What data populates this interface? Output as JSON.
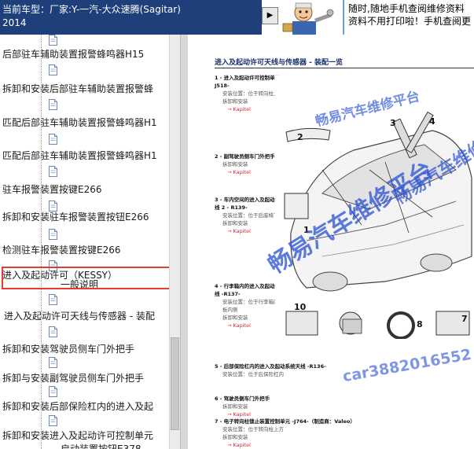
{
  "header": {
    "vehicle_label": "当前车型：厂家:Y-一汽-大众速腾(Sagitar)",
    "vehicle_year": "2014",
    "nav_button_icon": "play-forward-icon",
    "banner_line1": "随时,随地手机查阅维修资料",
    "banner_line2": "资料不用打印啦！手机查阅更"
  },
  "tree": {
    "items": [
      {
        "label": ""
      },
      {
        "label": "后部驻车辅助装置报警蜂鸣器H15"
      },
      {
        "label": ""
      },
      {
        "label": "拆卸和安装后部驻车辅助装置报警蜂"
      },
      {
        "label": ""
      },
      {
        "label": "匹配后部驻车辅助装置报警蜂鸣器H1"
      },
      {
        "label": ""
      },
      {
        "label": "匹配后部驻车辅助装置报警蜂鸣器H1"
      },
      {
        "label": ""
      },
      {
        "label": "驻车报警装置按键E266"
      },
      {
        "label": ""
      },
      {
        "label": "拆卸和安装驻车报警装置按钮E266"
      },
      {
        "label": ""
      },
      {
        "label": "检测驻车报警装置按键E266"
      },
      {
        "label": ""
      },
      {
        "label": "进入及起动许可（KESSY）"
      },
      {
        "label": "一般说明"
      },
      {
        "label": ""
      },
      {
        "label": "进入及起动许可天线与传感器 - 装配"
      },
      {
        "label": ""
      },
      {
        "label": "拆卸和安装驾驶员侧车门外把手"
      },
      {
        "label": ""
      },
      {
        "label": "拆卸与安装副驾驶员侧车门外把手"
      },
      {
        "label": ""
      },
      {
        "label": "拆卸和安装后部保险杠内的进入及起"
      },
      {
        "label": ""
      },
      {
        "label": "拆卸和安装进入及起动许可控制单元"
      },
      {
        "label": "启动装置按钮E378"
      }
    ],
    "selected_label": "进入及起动许可天线与传感器 - 装配"
  },
  "document": {
    "title": "进入及起动许可天线与传感器 - 装配一览",
    "items": [
      {
        "num": "1 -",
        "title": "进入及起动许可控制单元 -J518-",
        "sub": [
          "安装位置：位于转向柱上方",
          "拆卸和安装"
        ],
        "link": "→ Kapitel"
      },
      {
        "num": "2 -",
        "title": "副驾驶员侧车门外把手",
        "sub": [
          "拆卸和安装"
        ],
        "link": "→ Kapitel"
      },
      {
        "num": "3 -",
        "title": "车内空间的进入及起动系统天线 2 - R139-",
        "sub": [
          "安装位置：位于后座椅下方",
          "拆卸和安装"
        ],
        "link": "→ Kapitel"
      },
      {
        "num": "4 -",
        "title": "行李箱内的进入及起动系统天线 -R137-",
        "sub": [
          "安装位置：位于行李箱内装饰板内侧",
          "拆卸和安装"
        ],
        "link": "→ Kapitel"
      },
      {
        "num": "5 -",
        "title": "后部保险杠内的进入及起动系统天线 -R136-",
        "sub": [
          "安装位置：位于后保险杠内"
        ],
        "link": ""
      },
      {
        "num": "6 -",
        "title": "驾驶员侧车门外把手",
        "sub": [
          "拆卸和安装"
        ],
        "link": "→ Kapitel"
      },
      {
        "num": "7 -",
        "title": "电子转向柱锁止装置控制单元 -J764-（制造商：Valeo）",
        "sub": [
          "安装位置：位于转向柱上方",
          "拆卸和安装"
        ],
        "link": "→ Kapitel"
      }
    ],
    "callouts": [
      "1",
      "2",
      "3",
      "4",
      "7",
      "8",
      "9",
      "10"
    ]
  },
  "watermarks": {
    "platform_small": "畅易汽车维修平台",
    "platform_large": "畅易汽车维修平台",
    "platform_mid": "畅易汽车维修平台",
    "contact": "car3882016552"
  },
  "colors": {
    "header_bg": "#1f3f7a",
    "selection_border": "#e53b31",
    "link_red": "#d22233",
    "watermark_blue": "#2a4fd0"
  }
}
